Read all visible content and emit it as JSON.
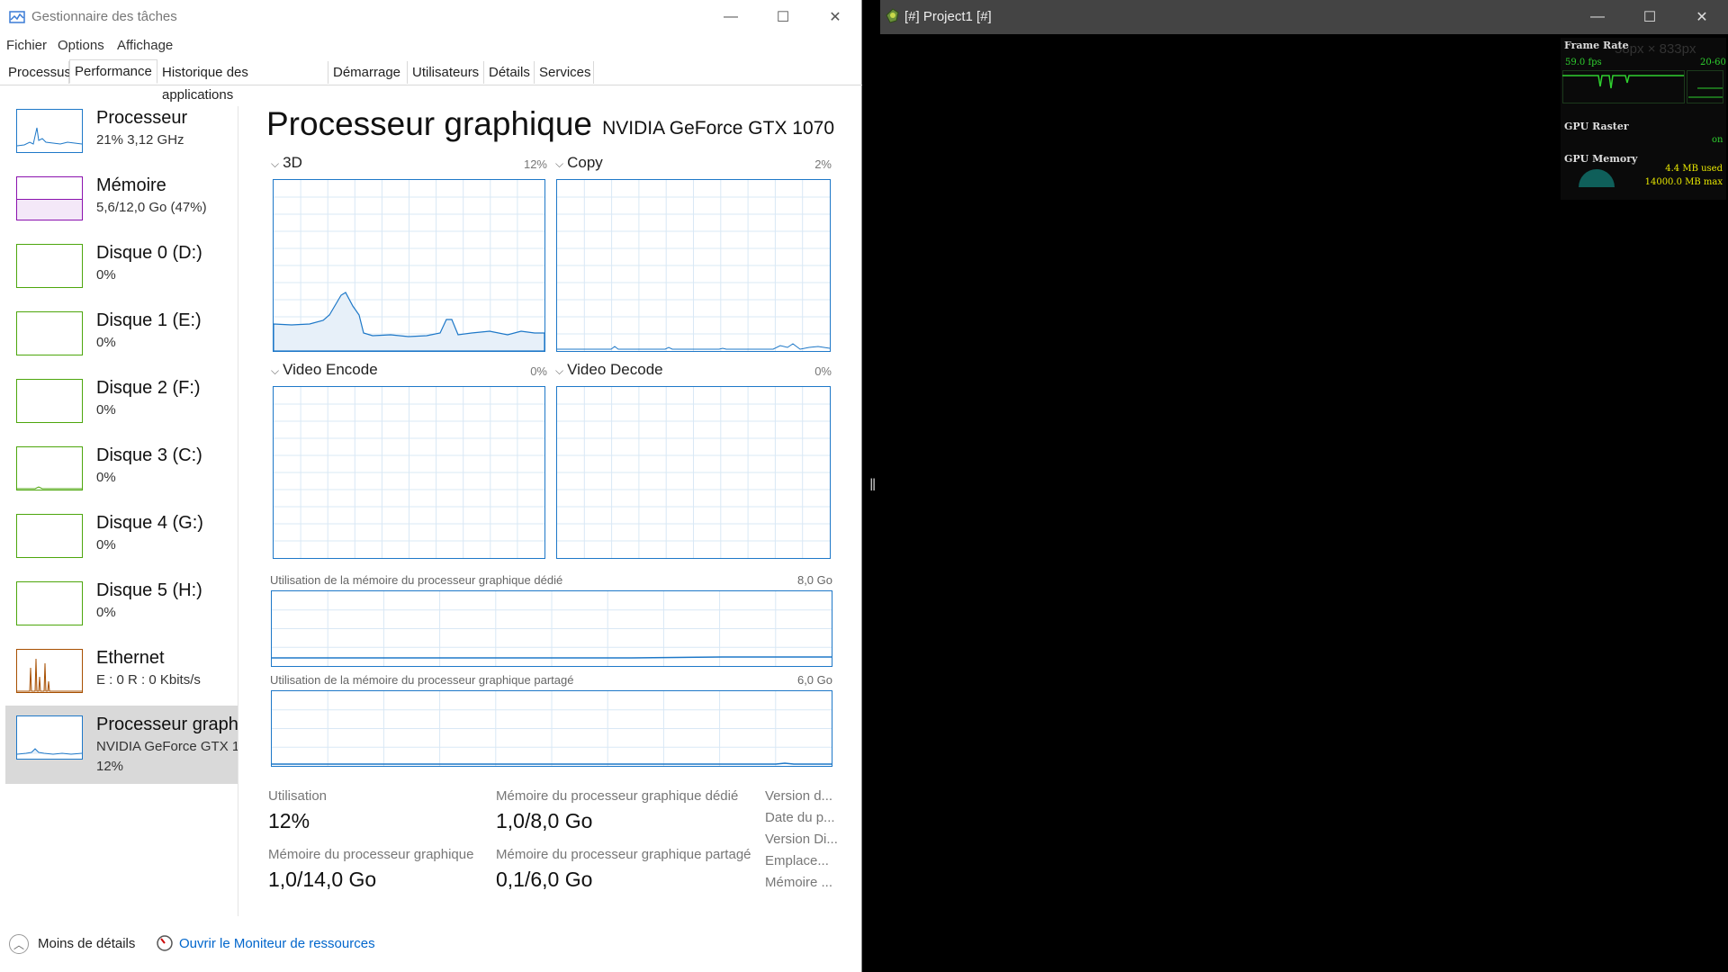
{
  "task_manager": {
    "title": "Gestionnaire des tâches",
    "window_buttons": {
      "minimize": "—",
      "maximize": "☐",
      "close": "✕"
    },
    "menu": [
      "Fichier",
      "Options",
      "Affichage"
    ],
    "tabs": [
      "Processus",
      "Performance",
      "Historique des applications",
      "Démarrage",
      "Utilisateurs",
      "Détails",
      "Services"
    ],
    "active_tab": "Performance",
    "sidebar": [
      {
        "name": "Processeur",
        "sub": "21% 3,12 GHz",
        "color": "#1e78c8",
        "level": 0.21
      },
      {
        "name": "Mémoire",
        "sub": "5,6/12,0 Go (47%)",
        "color": "#8b12ae",
        "level": 0.47
      },
      {
        "name": "Disque 0 (D:)",
        "sub": "0%",
        "color": "#4da60c",
        "level": 0
      },
      {
        "name": "Disque 1 (E:)",
        "sub": "0%",
        "color": "#4da60c",
        "level": 0
      },
      {
        "name": "Disque 2 (F:)",
        "sub": "0%",
        "color": "#4da60c",
        "level": 0
      },
      {
        "name": "Disque 3 (C:)",
        "sub": "0%",
        "color": "#4da60c",
        "level": 0
      },
      {
        "name": "Disque 4 (G:)",
        "sub": "0%",
        "color": "#4da60c",
        "level": 0
      },
      {
        "name": "Disque 5 (H:)",
        "sub": "0%",
        "color": "#4da60c",
        "level": 0
      },
      {
        "name": "Ethernet",
        "sub": "E : 0 R : 0 Kbits/s",
        "color": "#a74f01",
        "level": 0
      },
      {
        "name": "Processeur graphique 0",
        "sub": "NVIDIA GeForce GTX 1070",
        "sub2": "12%",
        "color": "#1e78c8",
        "level": 0.12,
        "selected": true
      }
    ],
    "main": {
      "title": "Processeur graphique",
      "device": "NVIDIA GeForce GTX 1070",
      "engines": [
        {
          "label": "3D",
          "pct": "12%"
        },
        {
          "label": "Copy",
          "pct": "2%"
        },
        {
          "label": "Video Encode",
          "pct": "0%"
        },
        {
          "label": "Video Decode",
          "pct": "0%"
        }
      ],
      "dedicated_memory": {
        "label": "Utilisation de la mémoire du processeur graphique dédié",
        "max": "8,0 Go"
      },
      "shared_memory": {
        "label": "Utilisation de la mémoire du processeur graphique partagé",
        "max": "6,0 Go"
      },
      "stats": [
        {
          "label": "Utilisation",
          "value": "12%"
        },
        {
          "label": "Mémoire du processeur graphique dédié",
          "value": "1,0/8,0 Go"
        },
        {
          "label": "Mémoire du processeur graphique",
          "value": "1,0/14,0 Go"
        },
        {
          "label": "Mémoire du processeur graphique partagé",
          "value": "0,1/6,0 Go"
        }
      ],
      "properties": [
        "Version d...",
        "Date du p...",
        "Version Di...",
        "Emplace...",
        "Mémoire ..."
      ]
    },
    "footer": {
      "less_details": "Moins de détails",
      "resource_monitor": "Ouvrir le Moniteur de ressources"
    }
  },
  "project": {
    "title": "[#] Project1 [#]",
    "window_buttons": {
      "minimize": "—",
      "maximize": "☐",
      "close": "✕"
    },
    "resize_handle": "‖",
    "overlay": {
      "size_ghost": "58px × 833px",
      "frame_rate_title": "Frame Rate",
      "fps": "59.0 fps",
      "fps_range": "20-60",
      "gpu_raster_title": "GPU Raster",
      "gpu_raster_state": "on",
      "gpu_memory_title": "GPU Memory",
      "mem_used": "4.4 MB used",
      "mem_max": "14000.0 MB max",
      "mem_fraction": 0.0003
    }
  }
}
